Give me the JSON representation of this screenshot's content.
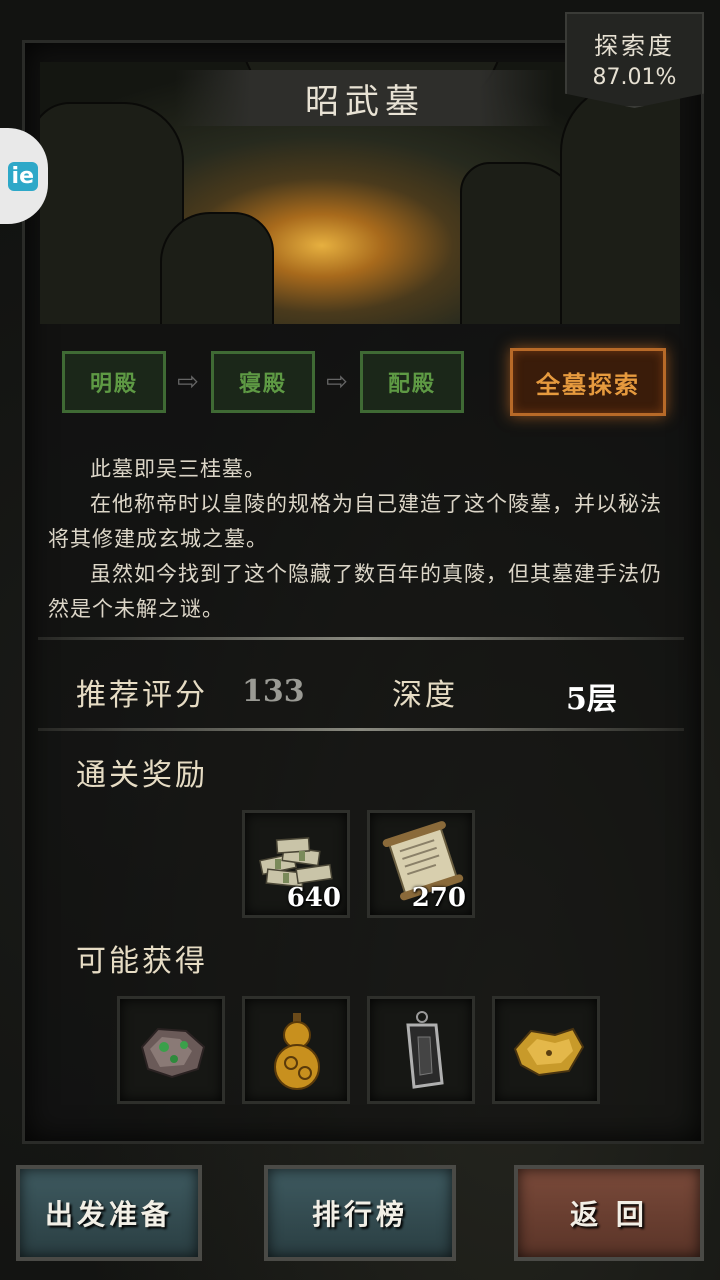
{
  "location_title": "昭武墓",
  "explore": {
    "label": "探索度",
    "value": "87.01%"
  },
  "side_badge": "ie",
  "stages": [
    "明殿",
    "寝殿",
    "配殿"
  ],
  "full_explore_label": "全墓探索",
  "description": [
    "此墓即吴三桂墓。",
    "在他称帝时以皇陵的规格为自己建造了这个陵墓，并以秘法将其修建成玄城之墓。",
    "虽然如今找到了这个隐藏了数百年的真陵，但其墓建手法仍然是个未解之谜。"
  ],
  "stats": {
    "score_label": "推荐评分",
    "score_value": "133",
    "depth_label": "深度",
    "depth_value": "5层"
  },
  "clear_rewards": {
    "title": "通关奖励",
    "items": [
      {
        "icon": "money-stack-icon",
        "count": "640"
      },
      {
        "icon": "scroll-icon",
        "count": "270"
      }
    ]
  },
  "possible_drops": {
    "title": "可能获得",
    "items": [
      {
        "icon": "jade-ore-icon"
      },
      {
        "icon": "golden-gourd-icon"
      },
      {
        "icon": "talisman-plate-icon"
      },
      {
        "icon": "gold-nugget-icon"
      }
    ]
  },
  "buttons": {
    "prepare": "出发准备",
    "ranking": "排行榜",
    "back": "返 回"
  },
  "colors": {
    "stage_green": "#5e9a44",
    "full_explore_orange": "#e69a3e",
    "score_grey": "#9a9a94",
    "depth_white": "#ffffff"
  }
}
